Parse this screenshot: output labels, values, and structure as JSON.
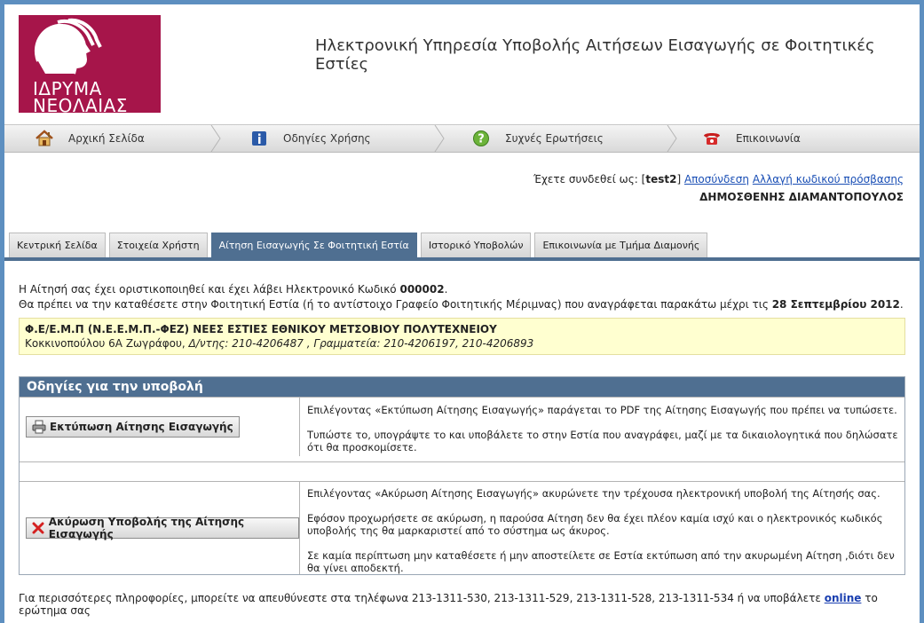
{
  "header": {
    "logo_line1": "ΙΔΡΥΜΑ",
    "logo_line2": "ΝΕΟΛΑΙΑΣ",
    "site_title": "Ηλεκτρονική Υπηρεσία Υποβολής Αιτήσεων Εισαγωγής σε Φοιτητικές Εστίες"
  },
  "nav": [
    {
      "label": "Αρχική Σελίδα",
      "icon": "home-icon"
    },
    {
      "label": "Οδηγίες Χρήσης",
      "icon": "info-icon"
    },
    {
      "label": "Συχνές Ερωτήσεις",
      "icon": "help-icon"
    },
    {
      "label": "Επικοινωνία",
      "icon": "phone-icon"
    }
  ],
  "user": {
    "prefix": "Έχετε συνδεθεί ως:",
    "username": "test2",
    "logout": "Αποσύνδεση",
    "change_password": "Αλλαγή κωδικού πρόσβασης",
    "full_name": "ΔΗΜΟΣΘΕΝΗΣ ΔΙΑΜΑΝΤΟΠΟΥΛΟΣ"
  },
  "tabs": [
    {
      "label": "Κεντρική Σελίδα",
      "active": false
    },
    {
      "label": "Στοιχεία Χρήστη",
      "active": false
    },
    {
      "label": "Αίτηση Εισαγωγής Σε Φοιτητική Εστία",
      "active": true
    },
    {
      "label": "Ιστορικό Υποβολών",
      "active": false
    },
    {
      "label": "Επικοινωνία με Τμήμα Διαμονής",
      "active": false
    }
  ],
  "message": {
    "line1_pre": "Η Αίτησή σας έχει οριστικοποιηθεί και έχει λάβει Ηλεκτρονικό Κωδικό",
    "code": "000002",
    "line2_pre": "Θα πρέπει να την καταθέσετε στην Φοιτητική Εστία (ή το αντίστοιχο Γραφείο Φοιτητικής Μέριμνας) που αναγράφεται παρακάτω μέχρι τις",
    "deadline": "28 Σεπτεμβρίου 2012"
  },
  "estia": {
    "name": "Φ.Ε/Ε.Μ.Π (Ν.Ε.Ε.Μ.Π.-ΦΕΖ) ΝΕΕΣ ΕΣΤΙΕΣ ΕΘΝΙΚΟΥ ΜΕΤΣΟΒΙΟΥ ΠΟΛΥΤΕΧΝΕΙΟΥ",
    "address": "Κοκκινοπούλου 6Α Ζωγράφου,",
    "contacts": "Δ/ντης: 210-4206487 , Γραμματεία: 210-4206197, 210-4206893"
  },
  "instructions": {
    "title": "Οδηγίες για την υποβολή",
    "print": {
      "button": "Εκτύπωση Αίτησης Εισαγωγής",
      "text1": "Επιλέγοντας «Εκτύπωση Αίτησης Εισαγωγής» παράγεται το PDF της Αίτησης Εισαγωγής που πρέπει να τυπώσετε.",
      "text2": "Τυπώστε το, υπογράψτε το και υποβάλετε το στην Εστία που αναγράφει, μαζί με τα δικαιολογητικά που δηλώσατε ότι θα προσκομίσετε."
    },
    "cancel": {
      "button": "Ακύρωση Υποβολής της Αίτησης Εισαγωγής",
      "text1": "Επιλέγοντας «Ακύρωση Αίτησης Εισαγωγής» ακυρώνετε την τρέχουσα ηλεκτρονική υποβολή της Αίτησής σας.",
      "text2": "Εφόσον προχωρήσετε σε ακύρωση, η παρούσα Αίτηση δεν θα έχει πλέον καμία ισχύ και ο ηλεκτρονικός κωδικός υποβολής της θα μαρκαριστεί από το σύστημα ως άκυρος.",
      "text3": "Σε καμία περίπτωση μην καταθέσετε ή μην αποστείλετε σε Εστία εκτύπωση από την ακυρωμένη Αίτηση ,διότι δεν θα γίνει αποδεκτή."
    }
  },
  "footer": {
    "text": "Για περισσότερες πληροφορίες, μπορείτε να απευθύνεστε στα τηλέφωνα 213-1311-530, 213-1311-529, 213-1311-528, 213-1311-534 ή να υποβάλετε",
    "link": "online",
    "suffix": "το ερώτημα σας"
  },
  "colors": {
    "brand": "#a6154a",
    "accent": "#4f6f91",
    "highlight": "#ffffd0"
  }
}
